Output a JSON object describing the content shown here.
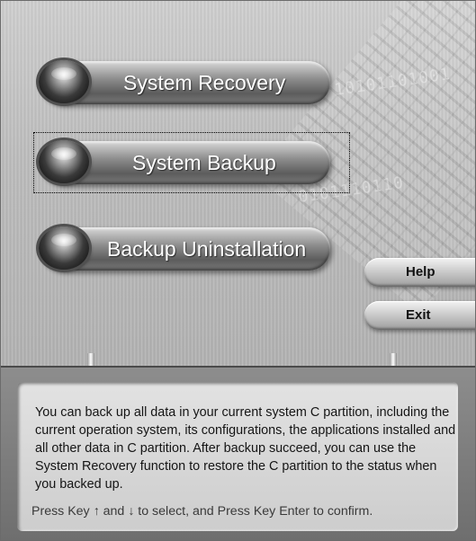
{
  "menu": {
    "system_recovery": "System Recovery",
    "system_backup": "System Backup",
    "backup_uninstallation": "Backup Uninstallation"
  },
  "side_buttons": {
    "help": "Help",
    "exit": "Exit"
  },
  "info": {
    "description": "You can back up all data in your current system C partition, including the current operation system, its configurations, the applications installed and all other data in C partition. After backup succeed, you can use the System Recovery function to restore the C partition to the status when you backed up.",
    "hint": "Press Key ↑ and ↓ to select, and Press Key Enter to confirm."
  },
  "selected_item": "System Backup",
  "colors": {
    "background": "#b8b8b8",
    "button_dark": "#5c5c5c",
    "text_light": "#ffffff"
  },
  "icons": [
    "orb-icon"
  ]
}
